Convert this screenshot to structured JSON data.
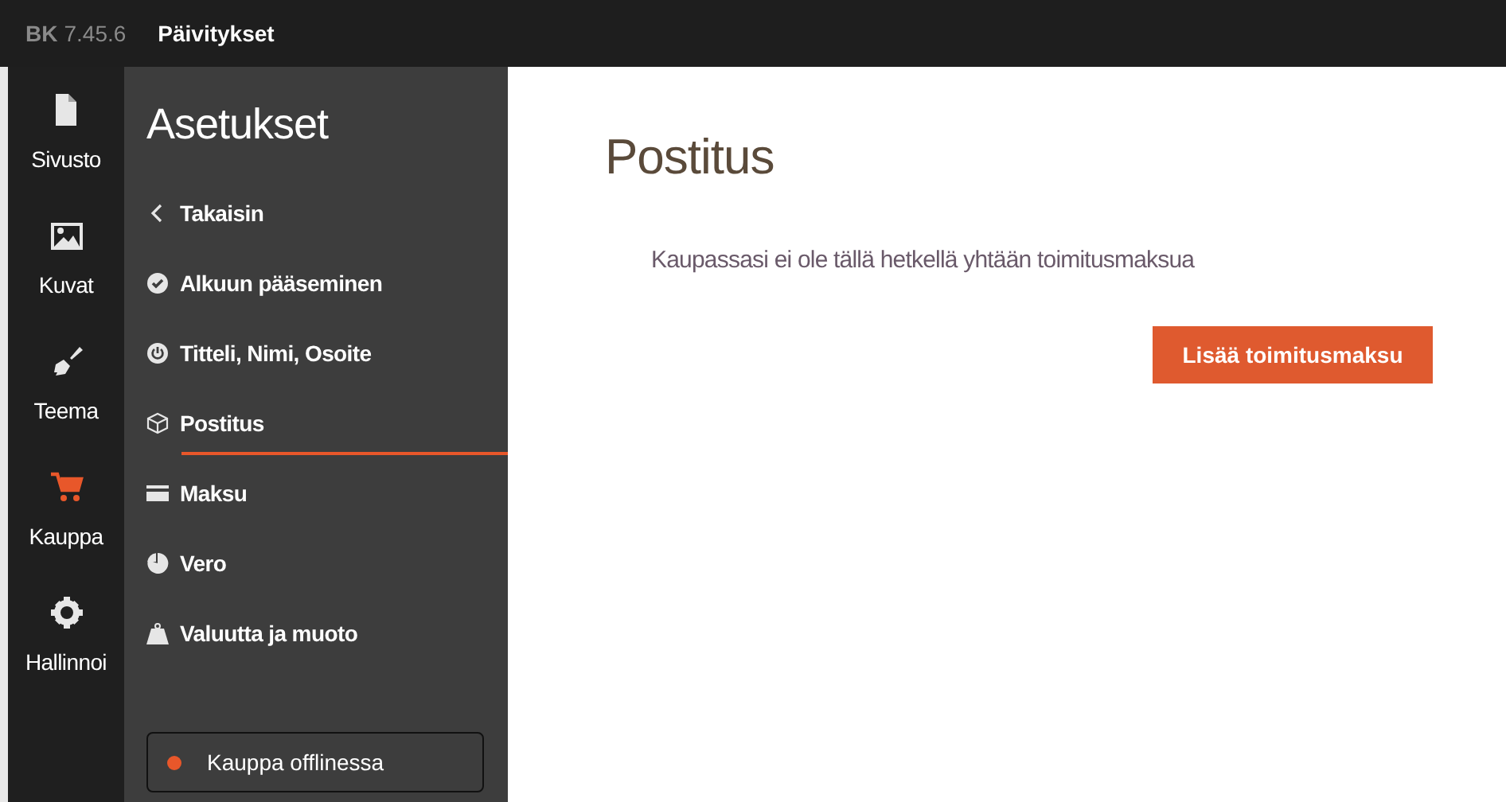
{
  "top_bar": {
    "logo": "BK",
    "version": "7.45.6",
    "link": "Päivitykset"
  },
  "rail": [
    {
      "label": "Sivusto",
      "selected": false
    },
    {
      "label": "Kuvat",
      "selected": false
    },
    {
      "label": "Teema",
      "selected": false
    },
    {
      "label": "Kauppa",
      "selected": true
    },
    {
      "label": "Hallinnoi",
      "selected": false
    }
  ],
  "settings": {
    "title": "Asetukset",
    "back": "Takaisin",
    "items": [
      {
        "label": "Alkuun pääseminen",
        "selected": false
      },
      {
        "label": "Titteli, Nimi, Osoite",
        "selected": false
      },
      {
        "label": "Postitus",
        "selected": true
      },
      {
        "label": "Maksu",
        "selected": false
      },
      {
        "label": "Vero",
        "selected": false
      },
      {
        "label": "Valuutta ja muoto",
        "selected": false
      }
    ],
    "status": {
      "label": "Kauppa offlinessa",
      "color": "#e8572a"
    }
  },
  "main": {
    "title": "Postitus",
    "message": "Kaupassasi ei ole tällä hetkellä yhtään toimitusmaksua",
    "button": "Lisää toimitusmaksu"
  }
}
